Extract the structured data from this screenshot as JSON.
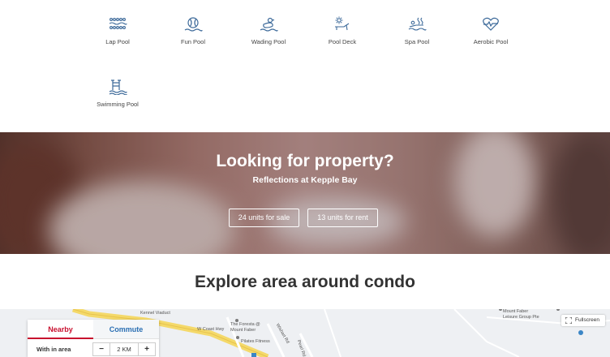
{
  "facilities": [
    {
      "label": "Lap Pool",
      "icon": "lap-pool-icon"
    },
    {
      "label": "Fun Pool",
      "icon": "fun-pool-icon"
    },
    {
      "label": "Wading Pool",
      "icon": "wading-pool-icon"
    },
    {
      "label": "Pool Deck",
      "icon": "pool-deck-icon"
    },
    {
      "label": "Spa Pool",
      "icon": "spa-pool-icon"
    },
    {
      "label": "Aerobic Pool",
      "icon": "aerobic-pool-icon"
    },
    {
      "label": "Swimming Pool",
      "icon": "swimming-pool-icon"
    }
  ],
  "hero": {
    "title": "Looking for property?",
    "subtitle": "Reflections at Kepple Bay",
    "sale_button": "24 units for sale",
    "rent_button": "13 units for rent"
  },
  "explore": {
    "title": "Explore area around condo"
  },
  "map": {
    "fullscreen_label": "Fullscreen",
    "labels": {
      "kennel_viaduct": "Kennel Viaduct",
      "w_coast_hwy": "W Coast Hwy",
      "foresta_line1": "The Foresta @",
      "foresta_line2": "Mount Faber",
      "pilates": "Pilates Fitness",
      "mount_faber_line1": "Mount Faber",
      "mount_faber_line2": "Leisure Group Pte",
      "wishart_rd": "Wishart Rd",
      "pearl_rd": "Pearl Rd"
    },
    "panel": {
      "tab_nearby": "Nearby",
      "tab_commute": "Commute",
      "within_label": "With in area",
      "minus": "−",
      "distance": "2 KM",
      "plus": "+"
    }
  },
  "colors": {
    "accent_red": "#c8102e",
    "link_blue": "#2b6fb3",
    "icon_blue": "#3d6a9a"
  }
}
